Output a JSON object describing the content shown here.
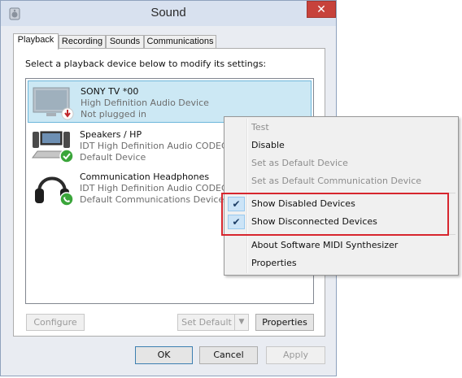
{
  "window": {
    "title": "Sound",
    "close_glyph": "✕",
    "icon": "speaker-icon"
  },
  "tabs": [
    {
      "label": "Playback",
      "active": true
    },
    {
      "label": "Recording",
      "active": false
    },
    {
      "label": "Sounds",
      "active": false
    },
    {
      "label": "Communications",
      "active": false
    }
  ],
  "playback": {
    "instruction": "Select a playback device below to modify its settings:",
    "devices": [
      {
        "name": "SONY TV  *00",
        "driver": "High Definition Audio Device",
        "status": "Not plugged in",
        "icon": "tv-icon",
        "badge": "unplugged",
        "selected": true
      },
      {
        "name": "Speakers / HP",
        "driver": "IDT High Definition Audio CODEC",
        "status": "Default Device",
        "icon": "speakers-icon",
        "badge": "default",
        "selected": false
      },
      {
        "name": "Communication Headphones",
        "driver": "IDT High Definition Audio CODEC",
        "status": "Default Communications Device",
        "icon": "headphones-icon",
        "badge": "communications-default",
        "selected": false
      }
    ],
    "configure_label": "Configure",
    "set_default_label": "Set Default",
    "properties_label": "Properties"
  },
  "footer": {
    "ok_label": "OK",
    "cancel_label": "Cancel",
    "apply_label": "Apply"
  },
  "context_menu": {
    "items": [
      {
        "label": "Test",
        "enabled": false,
        "checked": false
      },
      {
        "label": "Disable",
        "enabled": true,
        "checked": false
      },
      {
        "label": "Set as Default Device",
        "enabled": false,
        "checked": false
      },
      {
        "label": "Set as Default Communication Device",
        "enabled": false,
        "checked": false
      },
      {
        "label": "Show Disabled Devices",
        "enabled": true,
        "checked": true
      },
      {
        "label": "Show Disconnected Devices",
        "enabled": true,
        "checked": true
      },
      {
        "label": "About Software MIDI Synthesizer",
        "enabled": true,
        "checked": false
      },
      {
        "label": "Properties",
        "enabled": true,
        "checked": false
      }
    ],
    "check_glyph": "✔"
  },
  "colors": {
    "selection": "#cce8f4",
    "highlight_border": "#d7262e",
    "close_button": "#c7423b",
    "default_badge": "#3aa53a"
  }
}
